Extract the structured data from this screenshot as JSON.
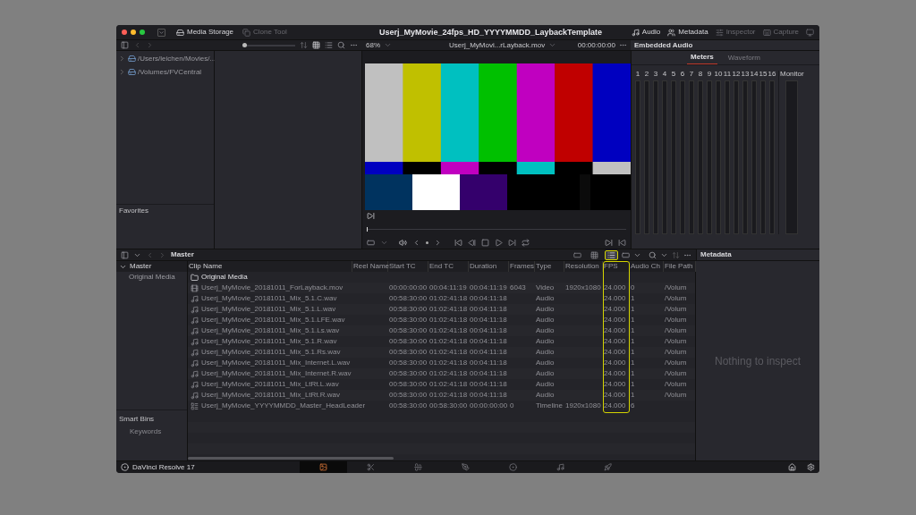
{
  "window": {
    "title": "Userj_MyMovie_24fps_HD_YYYYMMDD_LaybackTemplate"
  },
  "toolbar_left": [
    {
      "kind": "storage",
      "label": "Media Storage",
      "dimmed": false
    },
    {
      "kind": "clone",
      "label": "Clone Tool",
      "dimmed": true
    }
  ],
  "toolbar_right": [
    {
      "kind": "audio",
      "label": "Audio",
      "dimmed": false
    },
    {
      "kind": "metadata",
      "label": "Metadata",
      "dimmed": false
    },
    {
      "kind": "inspector",
      "label": "Inspector",
      "dimmed": true
    },
    {
      "kind": "capture",
      "label": "Capture",
      "dimmed": true
    }
  ],
  "media_storage": {
    "locations": [
      "/Users/leichen/Movies/...",
      "/Volumes/FVCentral"
    ],
    "favorites_title": "Favorites"
  },
  "browser_toolbar": {
    "thumbnail_size": {
      "level": 0.02
    }
  },
  "viewer": {
    "zoom": "68%",
    "clip": "Userj_MyMovi...rLayback.mov",
    "timecode": "00:00:00:00"
  },
  "audio": {
    "title": "Embedded Audio",
    "tabs": [
      {
        "label": "Meters",
        "selected": true
      },
      {
        "label": "Waveform",
        "selected": false
      }
    ],
    "channels": [
      "1",
      "2",
      "3",
      "4",
      "5",
      "6",
      "7",
      "8",
      "9",
      "10",
      "11",
      "12",
      "13",
      "14",
      "15",
      "16"
    ],
    "monitor": "Monitor"
  },
  "bins": {
    "title": "Master",
    "tree": [
      {
        "label": "Master",
        "expanded": true,
        "children": [
          {
            "label": "Original Media"
          }
        ]
      }
    ],
    "smart_bins_title": "Smart Bins",
    "smart_bins": [
      "Keywords"
    ]
  },
  "view_modes": [
    {
      "kind": "metadata",
      "selected": false,
      "highlighted": false
    },
    {
      "kind": "grid",
      "selected": false,
      "highlighted": false
    },
    {
      "kind": "list",
      "selected": true,
      "highlighted": true
    }
  ],
  "table": {
    "columns": [
      {
        "label": "Clip Name",
        "highlighted": false
      },
      {
        "label": "Reel Name",
        "highlighted": false
      },
      {
        "label": "Start TC",
        "highlighted": false
      },
      {
        "label": "End TC",
        "highlighted": false
      },
      {
        "label": "Duration",
        "highlighted": false
      },
      {
        "label": "Frames",
        "highlighted": false
      },
      {
        "label": "Type",
        "highlighted": false
      },
      {
        "label": "Resolution",
        "highlighted": false
      },
      {
        "label": "FPS",
        "highlighted": true
      },
      {
        "label": "Audio Ch",
        "highlighted": false
      },
      {
        "label": "File Path",
        "highlighted": false
      }
    ],
    "rows": [
      {
        "kind": "folder",
        "clip_name": "Original Media"
      },
      {
        "kind": "video",
        "clip_name": "Userj_MyMovie_20181011_ForLayback.mov",
        "start_tc": "00:00:00:00",
        "end_tc": "00:04:11:19",
        "duration": "00:04:11:19",
        "frames": "6043",
        "type": "Video",
        "resolution": "1920x1080",
        "fps": "24.000",
        "audio_ch": "0",
        "file_path": "/Volum"
      },
      {
        "kind": "audio",
        "clip_name": "Userj_MyMovie_20181011_Mix_5.1.C.wav",
        "start_tc": "00:58:30:00",
        "end_tc": "01:02:41:18",
        "duration": "00:04:11:18",
        "type": "Audio",
        "fps": "24.000",
        "audio_ch": "1",
        "file_path": "/Volum"
      },
      {
        "kind": "audio",
        "clip_name": "Userj_MyMovie_20181011_Mix_5.1.L.wav",
        "start_tc": "00:58:30:00",
        "end_tc": "01:02:41:18",
        "duration": "00:04:11:18",
        "type": "Audio",
        "fps": "24.000",
        "audio_ch": "1",
        "file_path": "/Volum"
      },
      {
        "kind": "audio",
        "clip_name": "Userj_MyMovie_20181011_Mix_5.1.LFE.wav",
        "start_tc": "00:58:30:00",
        "end_tc": "01:02:41:18",
        "duration": "00:04:11:18",
        "type": "Audio",
        "fps": "24.000",
        "audio_ch": "1",
        "file_path": "/Volum"
      },
      {
        "kind": "audio",
        "clip_name": "Userj_MyMovie_20181011_Mix_5.1.Ls.wav",
        "start_tc": "00:58:30:00",
        "end_tc": "01:02:41:18",
        "duration": "00:04:11:18",
        "type": "Audio",
        "fps": "24.000",
        "audio_ch": "1",
        "file_path": "/Volum"
      },
      {
        "kind": "audio",
        "clip_name": "Userj_MyMovie_20181011_Mix_5.1.R.wav",
        "start_tc": "00:58:30:00",
        "end_tc": "01:02:41:18",
        "duration": "00:04:11:18",
        "type": "Audio",
        "fps": "24.000",
        "audio_ch": "1",
        "file_path": "/Volum"
      },
      {
        "kind": "audio",
        "clip_name": "Userj_MyMovie_20181011_Mix_5.1.Rs.wav",
        "start_tc": "00:58:30:00",
        "end_tc": "01:02:41:18",
        "duration": "00:04:11:18",
        "type": "Audio",
        "fps": "24.000",
        "audio_ch": "1",
        "file_path": "/Volum"
      },
      {
        "kind": "audio",
        "clip_name": "Userj_MyMovie_20181011_Mix_Internet.L.wav",
        "start_tc": "00:58:30:00",
        "end_tc": "01:02:41:18",
        "duration": "00:04:11:18",
        "type": "Audio",
        "fps": "24.000",
        "audio_ch": "1",
        "file_path": "/Volum"
      },
      {
        "kind": "audio",
        "clip_name": "Userj_MyMovie_20181011_Mix_Internet.R.wav",
        "start_tc": "00:58:30:00",
        "end_tc": "01:02:41:18",
        "duration": "00:04:11:18",
        "type": "Audio",
        "fps": "24.000",
        "audio_ch": "1",
        "file_path": "/Volum"
      },
      {
        "kind": "audio",
        "clip_name": "Userj_MyMovie_20181011_Mix_LtRt.L.wav",
        "start_tc": "00:58:30:00",
        "end_tc": "01:02:41:18",
        "duration": "00:04:11:18",
        "type": "Audio",
        "fps": "24.000",
        "audio_ch": "1",
        "file_path": "/Volum"
      },
      {
        "kind": "audio",
        "clip_name": "Userj_MyMovie_20181011_Mix_LtRt.R.wav",
        "start_tc": "00:58:30:00",
        "end_tc": "01:02:41:18",
        "duration": "00:04:11:18",
        "type": "Audio",
        "fps": "24.000",
        "audio_ch": "1",
        "file_path": "/Volum"
      },
      {
        "kind": "timeline",
        "clip_name": "Userj_MyMovie_YYYYMMDD_Master_HeadLeader",
        "start_tc": "00:58:30:00",
        "end_tc": "00:58:30:00",
        "duration": "00:00:00:00",
        "frames": "0",
        "type": "Timeline",
        "resolution": "1920x1080",
        "fps": "24.000",
        "audio_ch": "6"
      }
    ]
  },
  "metadata": {
    "title": "Metadata",
    "empty_message": "Nothing to inspect"
  },
  "bottom_bar": {
    "app": "DaVinci Resolve 17",
    "pages": [
      {
        "kind": "media",
        "selected": true
      },
      {
        "kind": "cut",
        "selected": false
      },
      {
        "kind": "edit",
        "selected": false
      },
      {
        "kind": "fusion",
        "selected": false
      },
      {
        "kind": "color",
        "selected": false
      },
      {
        "kind": "fairlight",
        "selected": false
      },
      {
        "kind": "deliver",
        "selected": false
      }
    ]
  }
}
